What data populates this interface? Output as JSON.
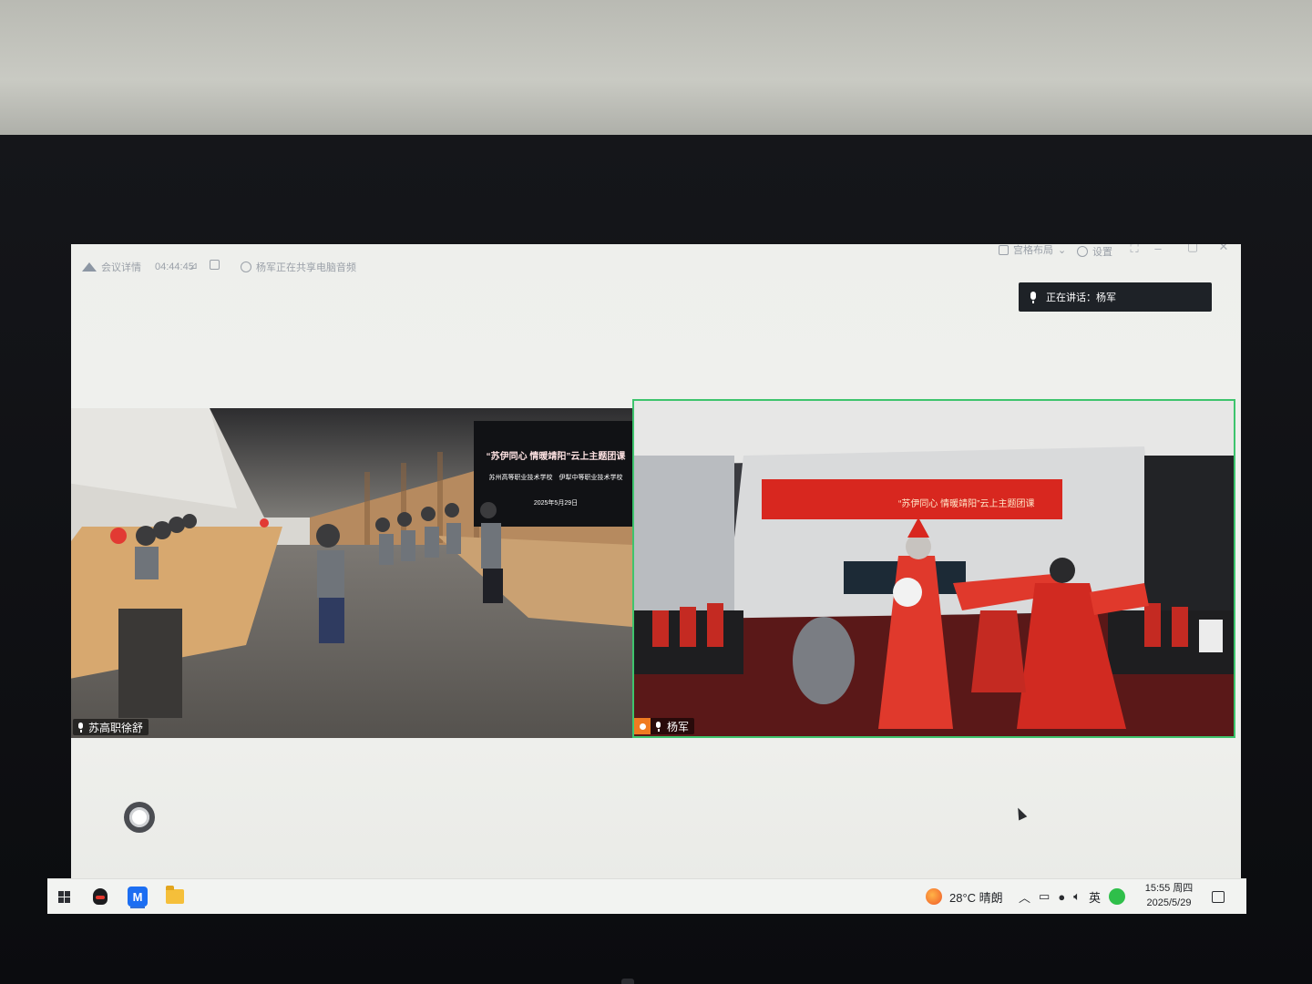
{
  "titlebar": {
    "app_name": "会议详情",
    "duration": "04:44:45",
    "share_notice": "杨军正在共享电脑音频",
    "layout_label": "宫格布局",
    "settings_label": "设置"
  },
  "speaking": {
    "label": "正在讲话：杨军"
  },
  "tiles": [
    {
      "name": "苏高职徐舒",
      "banner": {
        "title": "“苏伊同心 情暖靖阳”云上主题团课",
        "schools": "苏州高等职业技术学校　伊犁中等职业技术学校",
        "date": "2025年5月29日"
      }
    },
    {
      "name": "杨军",
      "banner": {
        "title": "“苏伊同心 情暖靖阳”云上主题团课"
      }
    }
  ],
  "taskbar": {
    "apps": [
      "start-icon",
      "qq-icon",
      "meeting-app-icon",
      "file-explorer-icon"
    ],
    "weather": "28°C  晴朗",
    "ime": "英",
    "time": "15:55 周四",
    "date": "2025/5/29"
  },
  "colors": {
    "active_speaker_border": "#3ec46d",
    "banner_red": "#d8271f",
    "accent_orange": "#f07b21"
  }
}
